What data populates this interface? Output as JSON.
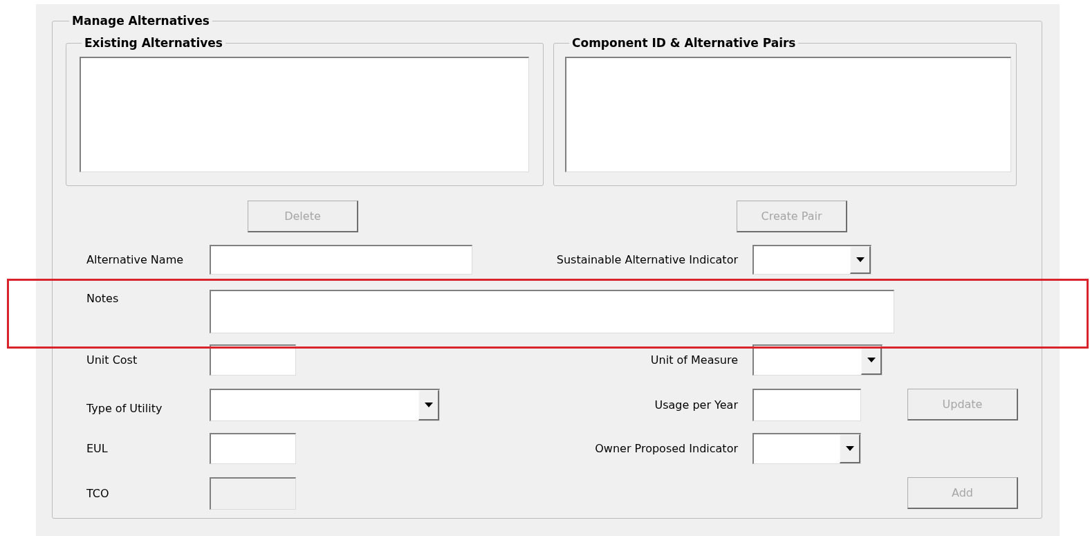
{
  "group": {
    "title": "Manage Alternatives"
  },
  "lists": [
    {
      "title": "Existing Alternatives"
    },
    {
      "title": "Component ID & Alternative Pairs"
    }
  ],
  "list_buttons": [
    {
      "label": "Delete",
      "disabled": true
    },
    {
      "label": "Create Pair",
      "disabled": true
    }
  ],
  "left_fields": [
    {
      "label": "Alternative Name",
      "kind": "text",
      "disabled": false
    },
    {
      "label": "Notes",
      "kind": "textarea",
      "disabled": false,
      "highlighted": true
    },
    {
      "label": "Unit Cost",
      "kind": "text",
      "disabled": false
    },
    {
      "label": "Type of Utility",
      "kind": "combo",
      "disabled": false
    },
    {
      "label": "EUL",
      "kind": "text",
      "disabled": false
    },
    {
      "label": "TCO",
      "kind": "text",
      "disabled": true
    }
  ],
  "right_fields": [
    {
      "label": "Sustainable Alternative Indicator",
      "kind": "combo",
      "disabled": false
    },
    {
      "label": "Unit of Measure",
      "kind": "combo",
      "disabled": false
    },
    {
      "label": "Usage per Year",
      "kind": "text",
      "disabled": false
    },
    {
      "label": "Owner Proposed Indicator",
      "kind": "combo",
      "disabled": false
    }
  ],
  "action_buttons": [
    {
      "label": "Update",
      "disabled": true
    },
    {
      "label": "Add",
      "disabled": true
    }
  ]
}
